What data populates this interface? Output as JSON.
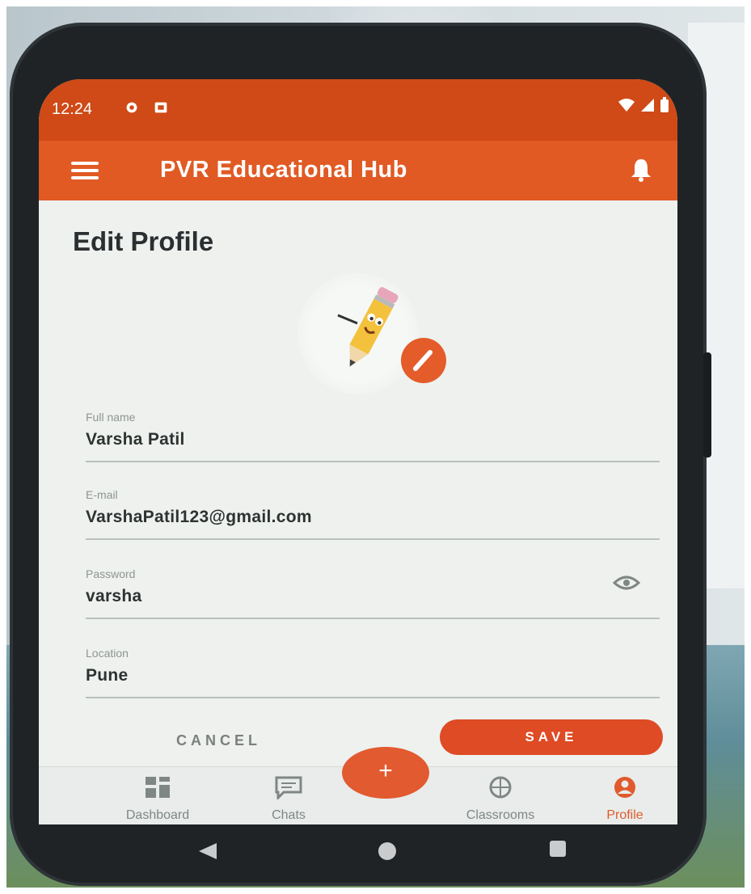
{
  "status_bar": {
    "time": "12:24"
  },
  "app_bar": {
    "title": "PVR Educational Hub"
  },
  "page": {
    "title": "Edit Profile"
  },
  "form": {
    "full_name": {
      "label": "Full name",
      "value": "Varsha Patil"
    },
    "email": {
      "label": "E-mail",
      "value": "VarshaPatil123@gmail.com"
    },
    "password": {
      "label": "Password",
      "value": "varsha"
    },
    "location": {
      "label": "Location",
      "value": "Pune"
    }
  },
  "actions": {
    "cancel_label": "CANCEL",
    "save_label": "SAVE"
  },
  "fab": {
    "label": "+"
  },
  "bottom_nav": {
    "items": [
      {
        "label": "Dashboard",
        "icon": "dashboard-icon"
      },
      {
        "label": "Chats",
        "icon": "chat-icon"
      },
      {
        "label": "Classrooms",
        "icon": "classroom-icon"
      },
      {
        "label": "Profile",
        "icon": "profile-icon",
        "active": true
      }
    ]
  },
  "colors": {
    "status_bar": "#cf4a16",
    "app_bar": "#e15a24",
    "accent": "#de4b25",
    "screen_bg": "#eef1ee"
  }
}
